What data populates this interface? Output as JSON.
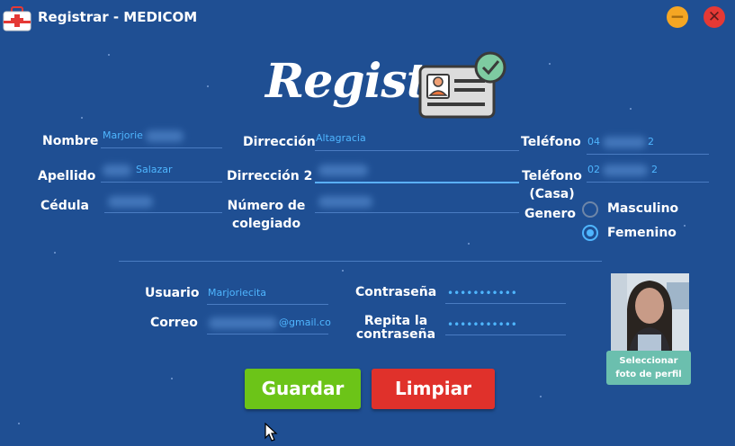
{
  "window": {
    "title": "Registrar - MEDICOM",
    "minimize_symbol": "−",
    "close_symbol": "✕"
  },
  "heading": "Registro",
  "labels": {
    "nombre": "Nombre",
    "apellido": "Apellido",
    "cedula": "Cédula",
    "direccion": "Dirrección",
    "direccion2": "Dirrección 2",
    "numero_colegiado": "Número de colegiado",
    "telefono": "Teléfono",
    "telefono_casa": "Teléfono (Casa)",
    "genero": "Genero",
    "usuario": "Usuario",
    "correo": "Correo",
    "contrasena": "Contraseña",
    "repita_contrasena": "Repita la contraseña"
  },
  "values": {
    "nombre": "Marjorie",
    "apellido": "Salazar",
    "cedula": "",
    "direccion": "Altagracia",
    "direccion2": "",
    "numero_colegiado": "",
    "telefono_prefix": "04",
    "telefono_suffix": "2",
    "telefono_casa_prefix": "02",
    "telefono_casa_suffix": "2",
    "usuario": "Marjoriecita",
    "correo_suffix": "@gmail.co",
    "contrasena": "•••••••••••",
    "repita_contrasena": "•••••••••••"
  },
  "gender": {
    "options": [
      "Masculino",
      "Femenino"
    ],
    "selected": "Femenino"
  },
  "photo_button": {
    "line1": "Seleccionar",
    "line2": "foto de perfil"
  },
  "buttons": {
    "save": "Guardar",
    "clear": "Limpiar"
  },
  "colors": {
    "background": "#1f4f93",
    "accent_text": "#4fb6ff",
    "save": "#6cc418",
    "clear": "#e0312b",
    "photo_button": "#6bbfae",
    "minimize": "#f5a623",
    "close": "#e53935"
  },
  "icons": {
    "app": "first-aid-kit-icon",
    "id_card": "id-card-check-icon",
    "cursor": "mouse-cursor-icon"
  }
}
